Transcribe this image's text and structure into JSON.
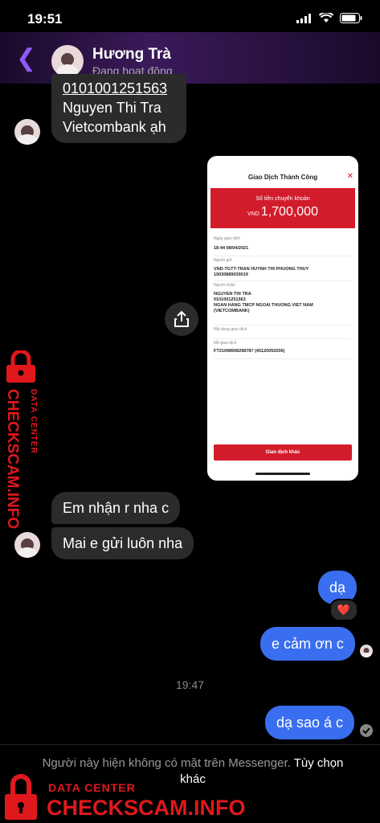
{
  "status_bar": {
    "time": "19:51"
  },
  "header": {
    "name": "Hương Trà",
    "status": "Đang hoạt động"
  },
  "messages": {
    "first_account": "0101001251563",
    "first_name": "Nguyen Thi Tra",
    "first_bank": "Vietcombank ạh",
    "recv1": "Em nhận r nha c",
    "recv2": "Mai e gửi luôn nha",
    "sent1": "dạ",
    "reaction": "❤️",
    "sent2": "e cảm ơn c",
    "time_sep": "19:47",
    "sent3": "dạ sao á c"
  },
  "receipt": {
    "title": "Giao Dịch Thành Công",
    "amount_label": "Số tiền chuyển khoản",
    "currency": "VND",
    "amount": "1,700,000",
    "date_label": "Ngày giao dịch",
    "date_value": "18:44 08/04/2021",
    "sender_label": "Người gửi",
    "sender_value1": "VND-TGTT-TRAN HUYNH THI PHUONG THUY",
    "sender_value2": "19030889030019",
    "receiver_label": "Người nhận",
    "receiver_value1": "NGUYEN THI TRA",
    "receiver_value2": "0101001251563",
    "receiver_value3": "NGAN HANG TMCP NGOAI THUONG VIET NAM",
    "receiver_value4": "(VIETCOMBANK)",
    "content_label": "Nội dung giao dịch",
    "code_label": "Mã giao dịch",
    "code_value": "FT21098908298787 (45120050206)",
    "button": "Giao dịch khác"
  },
  "footer": {
    "notice": "Người này hiện không có mặt trên Messenger.",
    "option": "Tùy chọn khác"
  },
  "watermark": {
    "line1": "DATA CENTER",
    "line2": "CHECKSCAM.INFO"
  },
  "colors": {
    "accent": "#3a6ef0",
    "back": "#8b5cf6",
    "bank_red": "#d21c2c"
  }
}
